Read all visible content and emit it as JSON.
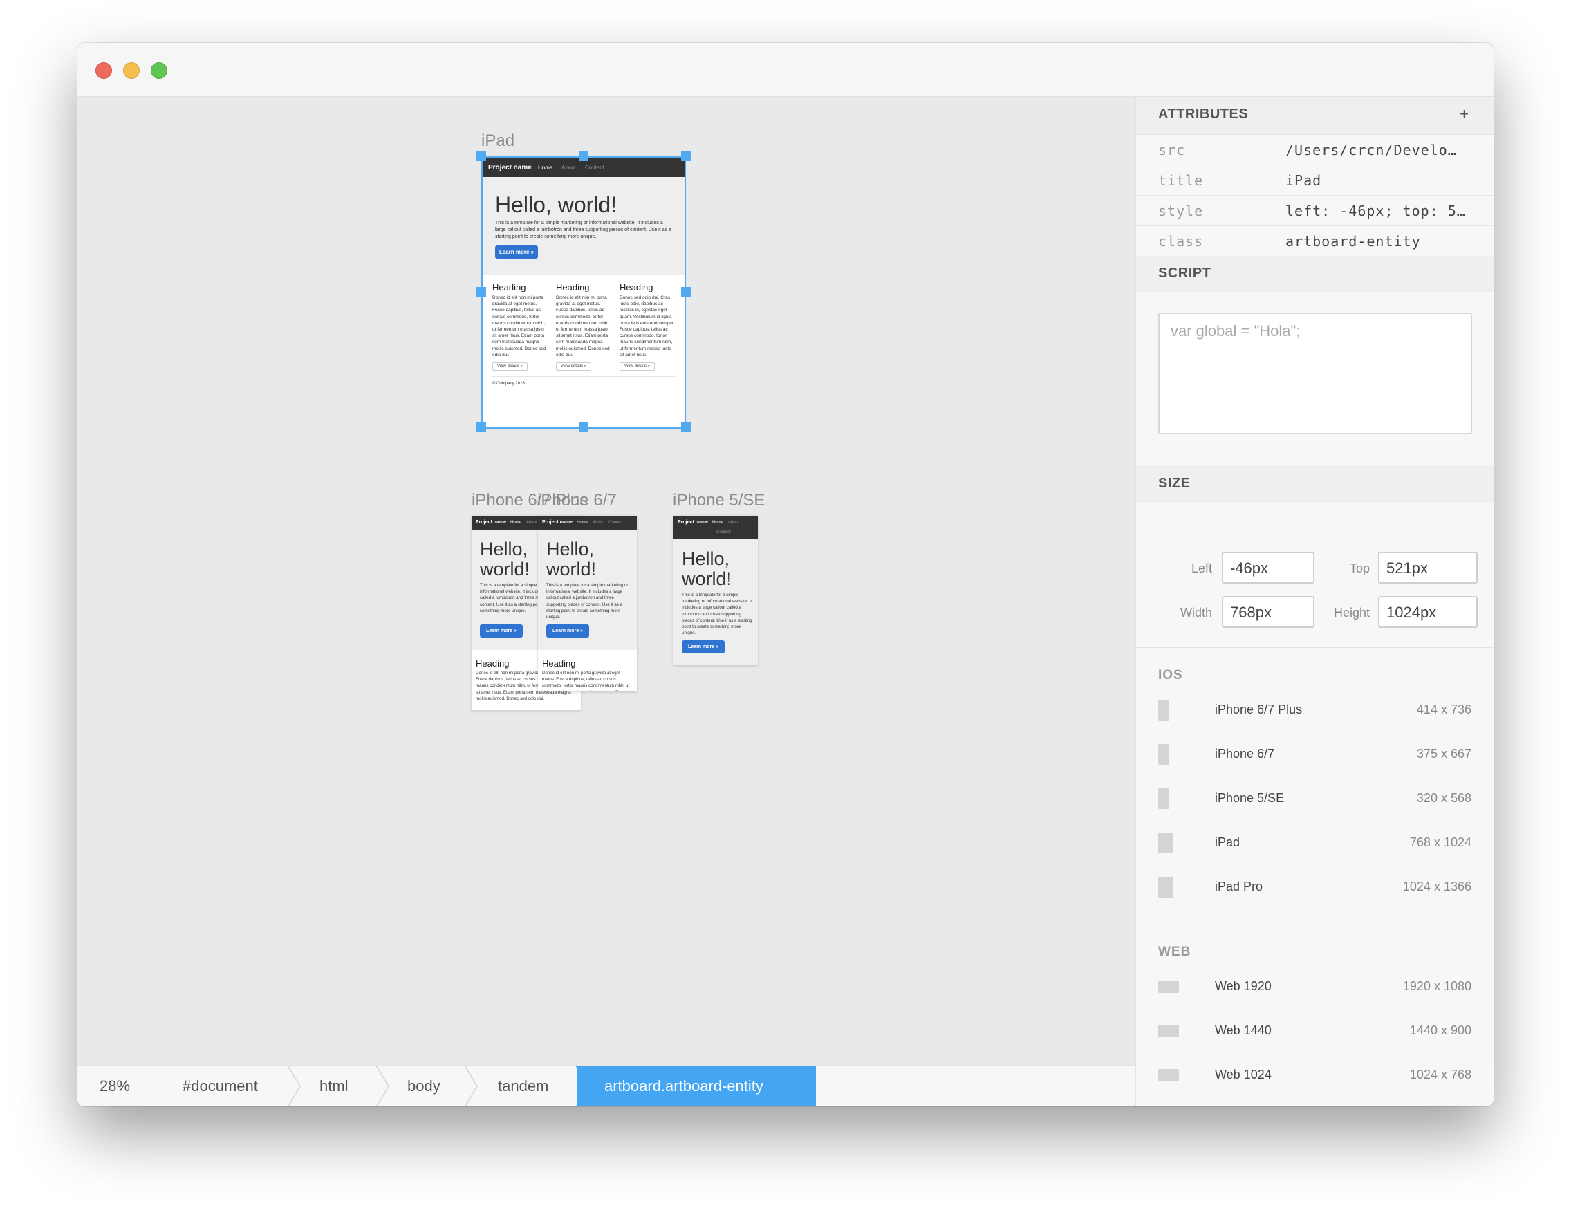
{
  "artboards": {
    "ipad_label": "iPad",
    "iphone_plus_label": "iPhone 6/7 Plus",
    "iphone_label": "iPhone 6/7",
    "iphone_se_label": "iPhone 5/SE"
  },
  "site": {
    "brand": "Project name",
    "nav_home": "Home",
    "nav_about": "About",
    "nav_contact": "Contact",
    "hero_title": "Hello, world!",
    "hero_title_line1": "Hello,",
    "hero_title_line2": "world!",
    "hero_text": "This is a template for a simple marketing or informational website. It includes a large callout called a jumbotron and three supporting pieces of content. Use it as a starting point to create something more unique.",
    "learn_more": "Learn more »",
    "columns": [
      {
        "heading": "Heading",
        "text": "Donec id elit non mi porta gravida at eget metus. Fusce dapibus, tellus ac cursus commodo, tortor mauris condimentum nibh, ut fermentum massa justo sit amet risus. Etiam porta sem malesuada magna mollis euismod. Donec sed odio dui.",
        "button": "View details »"
      },
      {
        "heading": "Heading",
        "text": "Donec id elit non mi porta gravida at eget metus. Fusce dapibus, tellus ac cursus commodo, tortor mauris condimentum nibh, ut fermentum massa justo sit amet risus. Etiam porta sem malesuada magna mollis euismod. Donec sed odio dui.",
        "button": "View details »"
      },
      {
        "heading": "Heading",
        "text": "Donec sed odio dui. Cras justo odio, dapibus ac facilisis in, egestas eget quam. Vestibulum id ligula porta felis euismod semper. Fusce dapibus, tellus ac cursus commodo, tortor mauris condimentum nibh, ut fermentum massa justo sit amet risus.",
        "button": "View details »"
      }
    ],
    "footer": "© Company 2016"
  },
  "panel": {
    "attributes_title": "ATTRIBUTES",
    "add_symbol": "+",
    "attributes": [
      {
        "key": "src",
        "value": "/Users/crcn/Develo…"
      },
      {
        "key": "title",
        "value": "iPad"
      },
      {
        "key": "style",
        "value": " left: -46px; top: 5…"
      },
      {
        "key": "class",
        "value": "artboard-entity"
      }
    ],
    "script_title": "SCRIPT",
    "script_placeholder": "var global = \"Hola\";",
    "size_title": "SIZE",
    "size": {
      "left_label": "Left",
      "left_value": "-46px",
      "top_label": "Top",
      "top_value": "521px",
      "width_label": "Width",
      "width_value": "768px",
      "height_label": "Height",
      "height_value": "1024px"
    },
    "ios_title": "IOS",
    "ios_devices": [
      {
        "name": "iPhone 6/7 Plus",
        "size": "414 x 736"
      },
      {
        "name": "iPhone 6/7",
        "size": "375 x 667"
      },
      {
        "name": "iPhone 5/SE",
        "size": "320 x 568"
      },
      {
        "name": "iPad",
        "size": "768 x 1024"
      },
      {
        "name": "iPad Pro",
        "size": "1024 x 1366"
      }
    ],
    "web_title": "WEB",
    "web_devices": [
      {
        "name": "Web 1920",
        "size": "1920 x 1080"
      },
      {
        "name": "Web 1440",
        "size": "1440 x 900"
      },
      {
        "name": "Web 1024",
        "size": "1024 x 768"
      }
    ]
  },
  "breadcrumb": {
    "zoom": "28%",
    "items": [
      "#document",
      "html",
      "body",
      "tandem"
    ],
    "active": "artboard.artboard-entity"
  },
  "colors": {
    "accent": "#44a6f2",
    "selection": "#52abf2",
    "button": "#2f74d0",
    "navbar": "#333333"
  }
}
